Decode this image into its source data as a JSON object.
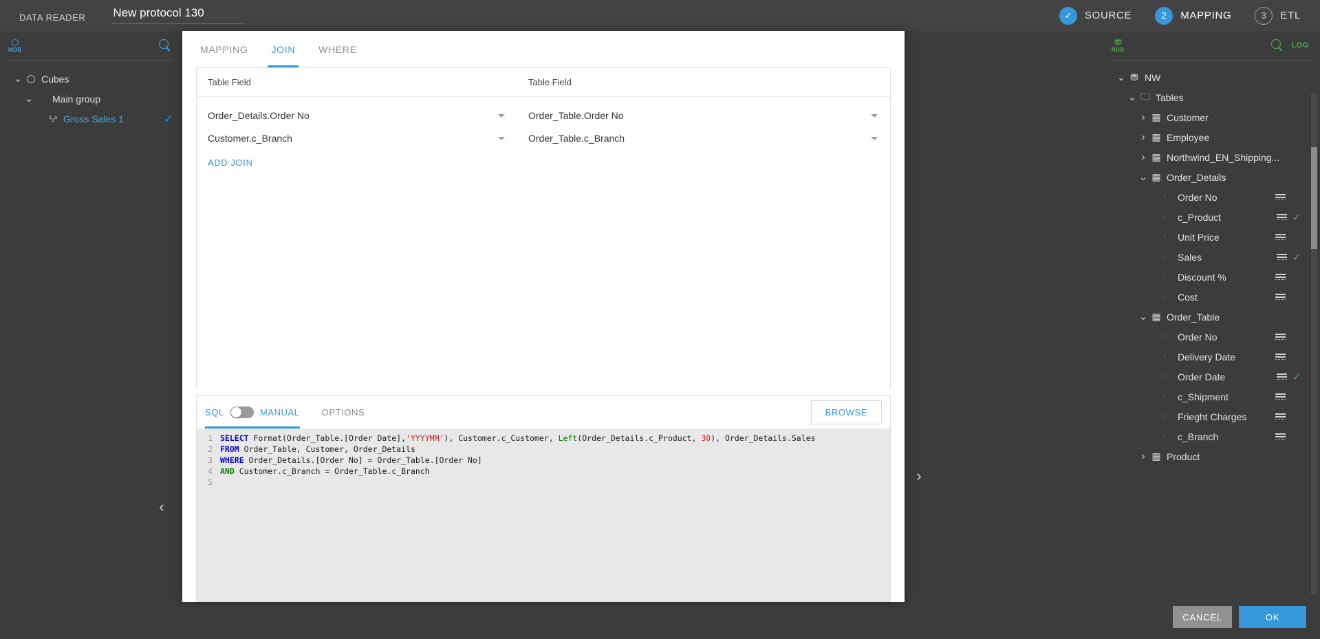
{
  "topbar": {
    "app_name": "DATA READER",
    "protocol_name": "New protocol 130",
    "steps": [
      {
        "marker": "✓",
        "label": "SOURCE",
        "state": "done"
      },
      {
        "marker": "2",
        "label": "MAPPING",
        "state": "active"
      },
      {
        "marker": "3",
        "label": "ETL",
        "state": "todo"
      }
    ]
  },
  "left_panel": {
    "source_tag": "MDB",
    "source_glyph": "⬡",
    "search_icon": "search-icon",
    "tree": [
      {
        "label": "Cubes",
        "icon": "cube-icon",
        "chevron": "down",
        "indent": 0,
        "checked": false,
        "blue": false
      },
      {
        "label": "Main group",
        "icon": "",
        "chevron": "down",
        "indent": 1,
        "checked": false,
        "blue": false
      },
      {
        "label": "Gross Sales 1",
        "icon": "123",
        "chevron": "none",
        "indent": 2,
        "checked": true,
        "blue": true
      }
    ],
    "nav_prev": "‹",
    "nav_next": "›"
  },
  "right_panel": {
    "source_tag": "RDB",
    "source_glyph": "⛃",
    "log_label": "LOG",
    "tree": [
      {
        "label": "NW",
        "icon": "db-icon",
        "chevron": "down",
        "indent": 0,
        "checked": false
      },
      {
        "label": "Tables",
        "icon": "folder-icon",
        "chevron": "down",
        "indent": 1,
        "checked": false
      },
      {
        "label": "Customer",
        "icon": "table-icon",
        "chevron": "right",
        "indent": 2,
        "checked": false
      },
      {
        "label": "Employee",
        "icon": "table-icon",
        "chevron": "right",
        "indent": 2,
        "checked": false
      },
      {
        "label": "Northwind_EN_Shipping...",
        "icon": "table-icon",
        "chevron": "right",
        "indent": 2,
        "checked": false
      },
      {
        "label": "Order_Details",
        "icon": "table-icon",
        "chevron": "down",
        "indent": 2,
        "checked": false
      },
      {
        "label": "Order No",
        "icon": "field",
        "chevron": "none",
        "indent": 3,
        "checked": false
      },
      {
        "label": "c_Product",
        "icon": "field",
        "chevron": "none",
        "indent": 3,
        "checked": true
      },
      {
        "label": "Unit Price",
        "icon": "field",
        "chevron": "none",
        "indent": 3,
        "checked": false
      },
      {
        "label": "Sales",
        "icon": "field",
        "chevron": "none",
        "indent": 3,
        "checked": true
      },
      {
        "label": "Discount %",
        "icon": "field",
        "chevron": "none",
        "indent": 3,
        "checked": false
      },
      {
        "label": "Cost",
        "icon": "field",
        "chevron": "none",
        "indent": 3,
        "checked": false
      },
      {
        "label": "Order_Table",
        "icon": "table-icon",
        "chevron": "down",
        "indent": 2,
        "checked": false
      },
      {
        "label": "Order No",
        "icon": "field",
        "chevron": "none",
        "indent": 3,
        "checked": false
      },
      {
        "label": "Delivery Date",
        "icon": "field",
        "chevron": "none",
        "indent": 3,
        "checked": false
      },
      {
        "label": "Order Date",
        "icon": "field",
        "chevron": "none",
        "indent": 3,
        "checked": true
      },
      {
        "label": "c_Shipment",
        "icon": "field",
        "chevron": "none",
        "indent": 3,
        "checked": false
      },
      {
        "label": "Frieght Charges",
        "icon": "field",
        "chevron": "none",
        "indent": 3,
        "checked": false
      },
      {
        "label": "c_Branch",
        "icon": "field",
        "chevron": "none",
        "indent": 3,
        "checked": false
      },
      {
        "label": "Product",
        "icon": "table-icon",
        "chevron": "right",
        "indent": 2,
        "checked": false
      }
    ]
  },
  "dialog": {
    "tabs": [
      {
        "label": "MAPPING",
        "active": false
      },
      {
        "label": "JOIN",
        "active": true
      },
      {
        "label": "WHERE",
        "active": false
      }
    ],
    "join": {
      "header_left": "Table Field",
      "header_right": "Table Field",
      "rows": [
        {
          "left": "Order_Details.Order No",
          "right": "Order_Table.Order No"
        },
        {
          "left": "Customer.c_Branch",
          "right": "Order_Table.c_Branch"
        }
      ],
      "add_join_label": "ADD JOIN"
    },
    "sql": {
      "sql_label": "SQL",
      "manual_label": "MANUAL",
      "options_label": "OPTIONS",
      "browse_label": "BROWSE",
      "toggle_on": false,
      "line_numbers": [
        "1",
        "2",
        "3",
        "4",
        "5"
      ],
      "lines": [
        "SELECT Format(Order_Table.[Order Date],'YYYYMM'), Customer.c_Customer, Left(Order_Details.c_Product, 30), Order_Details.Sales",
        "FROM Order_Table, Customer, Order_Details",
        "WHERE Order_Details.[Order No] = Order_Table.[Order No]",
        "AND Customer.c_Branch = Order_Table.c_Branch",
        ""
      ]
    }
  },
  "footer": {
    "cancel_label": "CANCEL",
    "ok_label": "OK"
  },
  "colors": {
    "accent": "#3498db",
    "green": "#4caf50",
    "panel_bg": "#3c3c3c",
    "topbar_bg": "#434343",
    "dialog_bg": "#ffffff"
  }
}
